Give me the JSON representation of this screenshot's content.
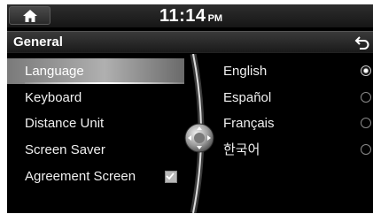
{
  "status_bar": {
    "home_icon": "home-icon",
    "time": "11:14",
    "ampm": "PM"
  },
  "header": {
    "title": "General",
    "back_icon": "back-arrow-icon"
  },
  "menu": {
    "items": [
      {
        "label": "Language",
        "selected": true
      },
      {
        "label": "Keyboard"
      },
      {
        "label": "Distance Unit"
      },
      {
        "label": "Screen Saver"
      },
      {
        "label": "Agreement Screen",
        "checkbox_checked": true
      }
    ]
  },
  "languages": {
    "options": [
      {
        "label": "English",
        "selected": true
      },
      {
        "label": "Español"
      },
      {
        "label": "Français"
      },
      {
        "label": "한국어"
      }
    ]
  },
  "colors": {
    "background": "#000000",
    "text": "#ffffff",
    "selected_bar": "#9a9a9a"
  }
}
